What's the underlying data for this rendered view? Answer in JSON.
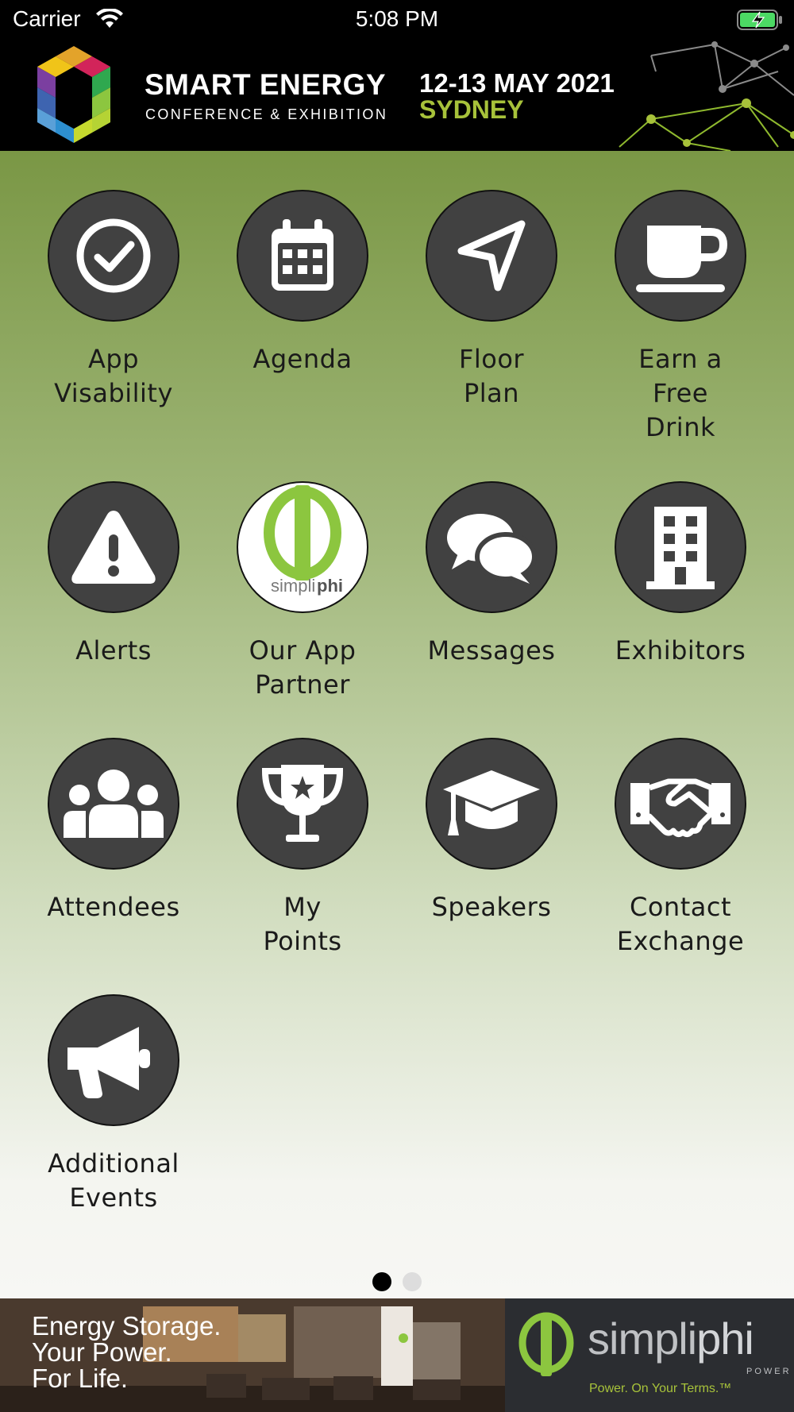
{
  "status_bar": {
    "carrier": "Carrier",
    "time": "5:08 PM",
    "battery_color": "#4cd964"
  },
  "banner": {
    "title": "SMART ENERGY",
    "subtitle": "CONFERENCE & EXHIBITION",
    "date": "12-13 MAY 2021",
    "city": "SYDNEY",
    "accent_color": "#a7c23a"
  },
  "grid": {
    "tiles": [
      {
        "label": "App\nVisability",
        "icon": "check-circle-icon"
      },
      {
        "label": "Agenda",
        "icon": "calendar-icon"
      },
      {
        "label": "Floor\nPlan",
        "icon": "navigation-arrow-icon"
      },
      {
        "label": "Earn a\nFree\nDrink",
        "icon": "coffee-cup-icon"
      },
      {
        "label": "Alerts",
        "icon": "warning-icon"
      },
      {
        "label": "Our App\nPartner",
        "icon": "simpliphi-logo-icon"
      },
      {
        "label": "Messages",
        "icon": "chat-bubbles-icon"
      },
      {
        "label": "Exhibitors",
        "icon": "building-icon"
      },
      {
        "label": "Attendees",
        "icon": "group-icon"
      },
      {
        "label": "My\nPoints",
        "icon": "trophy-icon"
      },
      {
        "label": "Speakers",
        "icon": "graduation-cap-icon"
      },
      {
        "label": "Contact\nExchange",
        "icon": "handshake-icon"
      },
      {
        "label": "Additional\nEvents",
        "icon": "megaphone-icon"
      }
    ],
    "partner_logo_text": {
      "simpli": "simpli",
      "phi": "phi",
      "tagline": "Power. On Your Terms."
    },
    "circle_color": "#414141"
  },
  "pager": {
    "pages": 2,
    "current": 1
  },
  "ad": {
    "tagline": "Energy Storage.\nYour Power.\nFor Life.",
    "brand_simpli": "simpli",
    "brand_phi": "phi",
    "brand_power": "POWER",
    "slogan": "Power. On Your Terms.™"
  }
}
